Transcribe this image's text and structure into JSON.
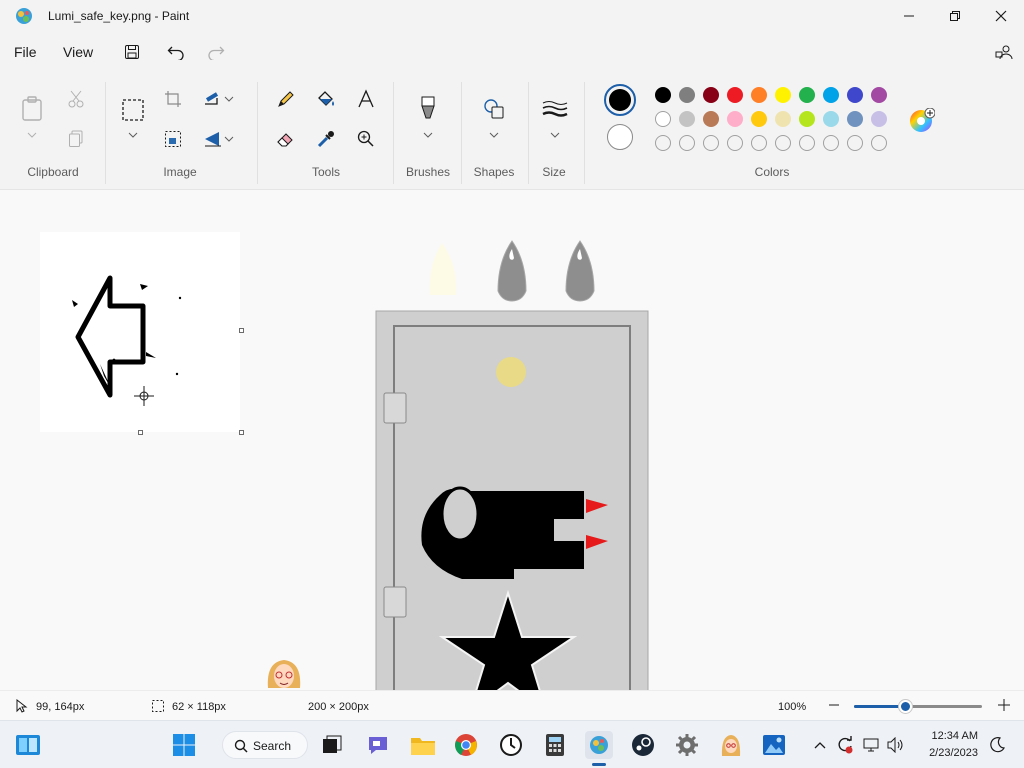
{
  "window": {
    "title": "Lumi_safe_key.png - Paint"
  },
  "menu": {
    "file": "File",
    "view": "View"
  },
  "ribbon": {
    "clipboard": "Clipboard",
    "image": "Image",
    "tools": "Tools",
    "brushes": "Brushes",
    "shapes": "Shapes",
    "size": "Size",
    "colors": "Colors"
  },
  "palette": {
    "row1": [
      "#000000",
      "#7f7f7f",
      "#880015",
      "#ed1c24",
      "#ff7f27",
      "#fff200",
      "#22b14c",
      "#00a2e8",
      "#3f48cc",
      "#a349a4"
    ],
    "row2": [
      "#ffffff",
      "#c3c3c3",
      "#b97a57",
      "#ffaec9",
      "#ffc90e",
      "#efe4b0",
      "#b5e61d",
      "#99d9ea",
      "#7092be",
      "#c8bfe7"
    ],
    "primary": "#000000",
    "secondary": "#ffffff"
  },
  "status": {
    "cursor": "99, 164px",
    "selection": "62 × 118px",
    "canvas_size": "200 × 200px",
    "zoom": "100%",
    "zoom_fraction": 0.4
  },
  "taskbar": {
    "search": "Search",
    "time": "12:34 AM",
    "date": "2/23/2023"
  }
}
